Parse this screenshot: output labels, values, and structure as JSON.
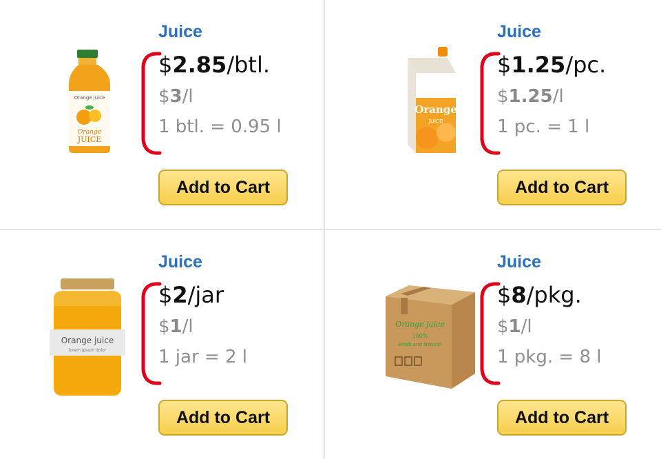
{
  "products": [
    {
      "category": "Juice",
      "currency": "$",
      "price_amount": "2.85",
      "price_unit": "/btl.",
      "unit_price_amount": "3",
      "unit_price_unit": "/l",
      "pack_info": "1 btl. = 0.95 l",
      "button_label": "Add to Cart",
      "image_label_1": "Orange juice",
      "image_label_2": "Orange",
      "image_label_3": "JUICE"
    },
    {
      "category": "Juice",
      "currency": "$",
      "price_amount": "1.25",
      "price_unit": "/pc.",
      "unit_price_amount": "1.25",
      "unit_price_unit": "/l",
      "pack_info": "1 pc. = 1 l",
      "button_label": "Add to Cart",
      "image_label_1": "Orange",
      "image_label_2": "juice"
    },
    {
      "category": "Juice",
      "currency": "$",
      "price_amount": "2",
      "price_unit": "/jar",
      "unit_price_amount": "1",
      "unit_price_unit": "/l",
      "pack_info": "1 jar = 2 l",
      "button_label": "Add to Cart",
      "image_label_1": "Orange juice",
      "image_label_2": "lorem ipsum dolor"
    },
    {
      "category": "Juice",
      "currency": "$",
      "price_amount": "8",
      "price_unit": "/pkg.",
      "unit_price_amount": "1",
      "unit_price_unit": "/l",
      "pack_info": "1 pkg. = 8 l",
      "button_label": "Add to Cart",
      "image_label_1": "Orange juice",
      "image_label_2": "100%",
      "image_label_3": "Fresh and Natural"
    }
  ],
  "colors": {
    "category": "#2a6fc0",
    "bracket": "#e0001b",
    "button_top": "#ffe58f",
    "button_bottom": "#f7cf4d",
    "divider": "#e3e3e3"
  }
}
